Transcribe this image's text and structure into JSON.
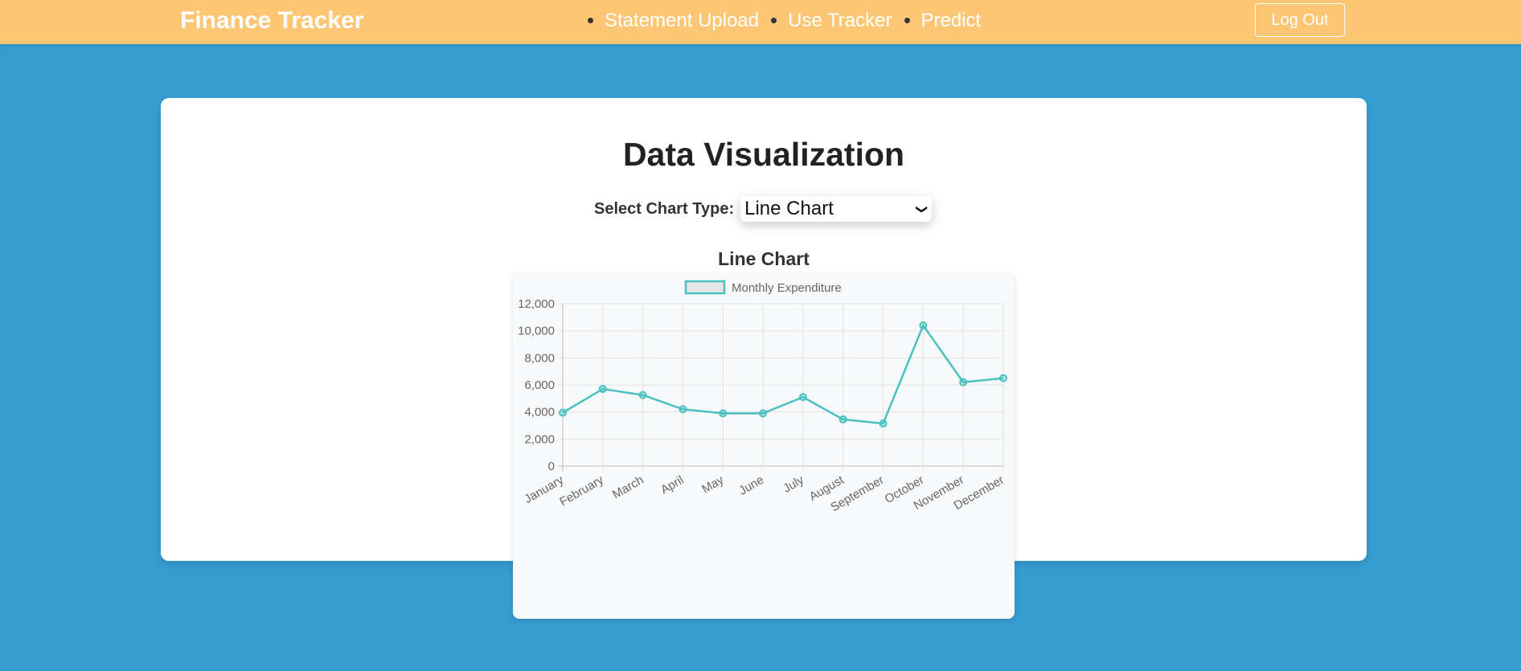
{
  "navbar": {
    "brand": "Finance Tracker",
    "links": [
      "Statement Upload",
      "Use Tracker",
      "Predict"
    ],
    "logout_label": "Log Out"
  },
  "main": {
    "title": "Data Visualization",
    "select_label": "Select Chart Type:",
    "select_value": "Line Chart",
    "chart_heading": "Line Chart"
  },
  "colors": {
    "navbar": "#fdc674",
    "background": "#369dd0",
    "line": "#4bc0c0"
  },
  "chart_data": {
    "type": "line",
    "title": "Line Chart",
    "categories": [
      "January",
      "February",
      "March",
      "April",
      "May",
      "June",
      "July",
      "August",
      "September",
      "October",
      "November",
      "December"
    ],
    "series": [
      {
        "name": "Monthly Expenditure",
        "values": [
          3950,
          5700,
          5250,
          4200,
          3900,
          3900,
          5100,
          3450,
          3150,
          10400,
          6200,
          6500
        ]
      }
    ],
    "ylim": [
      0,
      12000
    ],
    "yticks": [
      "0",
      "2,000",
      "4,000",
      "6,000",
      "8,000",
      "10,000",
      "12,000"
    ],
    "grid": true,
    "legend": "top"
  }
}
